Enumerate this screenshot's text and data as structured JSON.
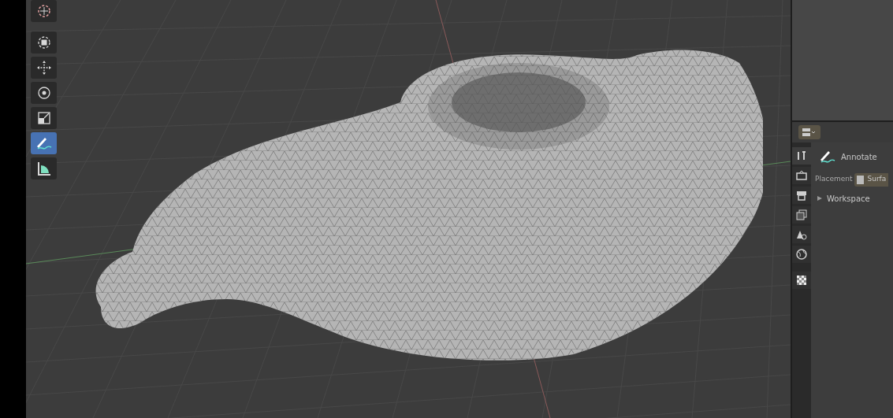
{
  "toolbar": {
    "tools": [
      {
        "kind": "cursor",
        "selected": false
      },
      {
        "kind": "select",
        "selected": false
      },
      {
        "kind": "move",
        "selected": false
      },
      {
        "kind": "rotate",
        "selected": false
      },
      {
        "kind": "scale",
        "selected": false
      },
      {
        "kind": "annotate",
        "selected": true
      },
      {
        "kind": "measure",
        "selected": false
      }
    ]
  },
  "properties": {
    "tabs": [
      {
        "kind": "tool",
        "selected": true
      },
      {
        "kind": "render",
        "selected": false
      },
      {
        "kind": "output",
        "selected": false
      },
      {
        "kind": "view_layer",
        "selected": false
      },
      {
        "kind": "scene",
        "selected": false
      },
      {
        "kind": "world",
        "selected": false
      },
      {
        "kind": "texture",
        "selected": false
      }
    ],
    "active_tool": "Annotate",
    "placement": {
      "label": "Placement",
      "value": "Surfa"
    },
    "panels": [
      {
        "title": "Workspace",
        "expanded": false
      }
    ]
  }
}
